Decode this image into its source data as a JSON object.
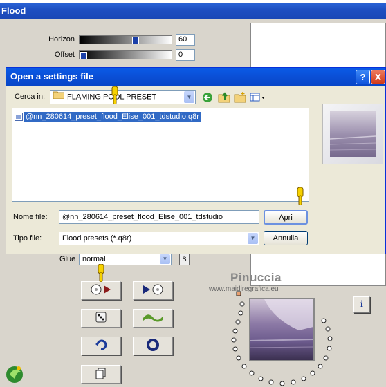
{
  "flood": {
    "title": "Flood",
    "horizon": {
      "label": "Horizon",
      "value": "60"
    },
    "offset": {
      "label": "Offset",
      "value": "0"
    },
    "glue": {
      "label": "Glue",
      "value": "normal",
      "s_button": "S"
    }
  },
  "dialog": {
    "title": "Open a settings file",
    "look_in_label": "Cerca in:",
    "look_in_value": "FLAMING POOL PRESET",
    "file_item": "@nn_280614_preset_flood_Elise_001_tdstudio.q8r",
    "filename_label": "Nome file:",
    "filename_value": "@nn_280614_preset_flood_Elise_001_tdstudio",
    "filetype_label": "Tipo file:",
    "filetype_value": "Flood presets (*.q8r)",
    "open_button": "Apri",
    "cancel_button": "Annulla",
    "help_button": "?",
    "close_button": "X"
  },
  "watermark": {
    "name": "Pinuccia",
    "url": "www.maidiregrafica.eu"
  },
  "info_button": "i",
  "colors": {
    "xp_blue": "#0a4fd6",
    "selection": "#316ac5",
    "close_red": "#e0523b",
    "panel": "#d9d5cc"
  }
}
